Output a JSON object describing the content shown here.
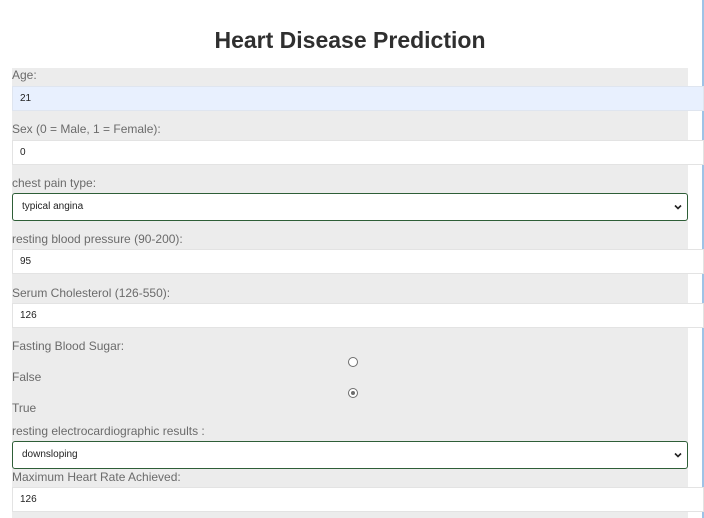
{
  "page": {
    "title": "Heart Disease Prediction"
  },
  "form": {
    "age": {
      "label": "Age:",
      "value": "21"
    },
    "sex": {
      "label": "Sex (0 = Male, 1 = Female):",
      "value": "0"
    },
    "chest_pain": {
      "label": "chest pain type:",
      "selected": "typical angina"
    },
    "resting_bp": {
      "label": "resting blood pressure (90-200):",
      "value": "95"
    },
    "cholesterol": {
      "label": "Serum Cholesterol (126-550):",
      "value": "126"
    },
    "fasting_blood_sugar": {
      "label": "Fasting Blood Sugar:",
      "options": [
        {
          "label": "False",
          "checked": false
        },
        {
          "label": "True",
          "checked": true
        }
      ]
    },
    "restecg": {
      "label": "resting electrocardiographic results :",
      "selected": "downsloping"
    },
    "max_heart_rate": {
      "label": "Maximum Heart Rate Achieved:",
      "value": "126"
    }
  }
}
